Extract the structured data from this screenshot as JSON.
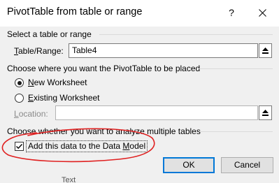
{
  "window": {
    "title": "PivotTable from table or range",
    "help_label": "?",
    "close_icon": "close-icon"
  },
  "section1": {
    "heading": "Select a table or range",
    "range_label_underlined": "T",
    "range_label_rest": "able/Range:",
    "range_value": "Table4",
    "collapse_icon": "range-select-icon"
  },
  "section2": {
    "heading": "Choose where you want the PivotTable to be placed",
    "options": [
      {
        "underlined": "N",
        "rest": "ew Worksheet",
        "selected": true
      },
      {
        "underlined": "E",
        "rest": "xisting Worksheet",
        "selected": false
      }
    ],
    "location_label_underlined": "L",
    "location_label_rest": "ocation:",
    "location_value": ""
  },
  "section3": {
    "heading": "Choose whether you want to analyze multiple tables",
    "checkbox_label_pre": "Add this data to the Data ",
    "checkbox_label_underlined": "M",
    "checkbox_label_post": "odel",
    "checked": true
  },
  "buttons": {
    "ok": "OK",
    "cancel": "Cancel"
  },
  "background": {
    "partial_text": "Text"
  },
  "colors": {
    "annotation": "#e02020",
    "default_button_border": "#0078d7"
  }
}
